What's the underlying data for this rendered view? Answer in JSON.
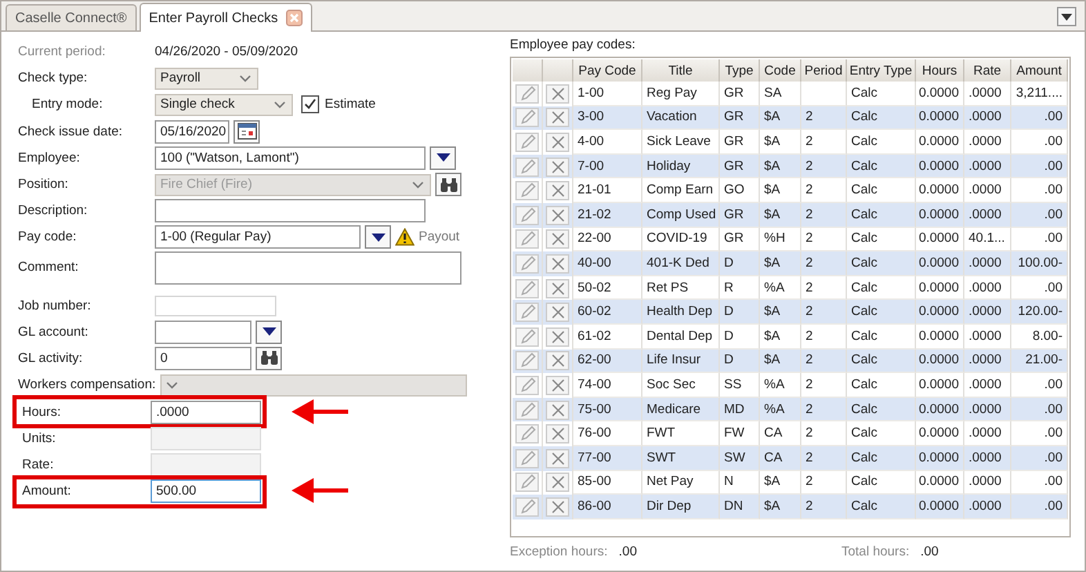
{
  "tabs": [
    {
      "label": "Caselle Connect®",
      "selected": false,
      "closable": false
    },
    {
      "label": "Enter Payroll Checks",
      "selected": true,
      "closable": true
    }
  ],
  "form": {
    "current_period": {
      "label": "Current period:",
      "value": "04/26/2020 - 05/09/2020"
    },
    "check_type": {
      "label": "Check type:",
      "value": "Payroll"
    },
    "entry_mode": {
      "label": "Entry mode:",
      "value": "Single check"
    },
    "estimate": {
      "label": "Estimate",
      "checked": true
    },
    "check_issue_date": {
      "label": "Check issue date:",
      "value": "05/16/2020"
    },
    "employee": {
      "label": "Employee:",
      "value": "100 (\"Watson, Lamont\")"
    },
    "position": {
      "label": "Position:",
      "value": "Fire Chief (Fire)",
      "disabled": true
    },
    "description": {
      "label": "Description:"
    },
    "pay_code": {
      "label": "Pay code:",
      "value": "1-00 (Regular Pay)",
      "warning": true,
      "payout": "Payout"
    },
    "comment": {
      "label": "Comment:"
    },
    "job_number": {
      "label": "Job number:"
    },
    "gl_account": {
      "label": "GL account:"
    },
    "gl_activity": {
      "label": "GL activity:",
      "value": "0"
    },
    "workers_compensation": {
      "label": "Workers compensation:",
      "disabled": true
    },
    "hours": {
      "label": "Hours:",
      "value": ".0000",
      "highlighted": true,
      "disabled": false
    },
    "units": {
      "label": "Units:",
      "highlighted": false,
      "disabled": true
    },
    "rate": {
      "label": "Rate:",
      "highlighted": false,
      "disabled": true
    },
    "amount": {
      "label": "Amount:",
      "value": "500.00",
      "highlighted": true,
      "disabled": false
    }
  },
  "pay_codes": {
    "title": "Employee pay codes:",
    "columns": [
      "Pay Code",
      "Title",
      "Type",
      "Code",
      "Period",
      "Entry Type",
      "Hours",
      "Rate",
      "Amount"
    ],
    "rows": [
      [
        "1-00",
        "Reg Pay",
        "GR",
        "SA",
        "",
        "Calc",
        "0.0000",
        ".0000",
        "3,211...."
      ],
      [
        "3-00",
        "Vacation",
        "GR",
        "$A",
        "2",
        "Calc",
        "0.0000",
        ".0000",
        ".00"
      ],
      [
        "4-00",
        "Sick Leave",
        "GR",
        "$A",
        "2",
        "Calc",
        "0.0000",
        ".0000",
        ".00"
      ],
      [
        "7-00",
        "Holiday",
        "GR",
        "$A",
        "2",
        "Calc",
        "0.0000",
        ".0000",
        ".00"
      ],
      [
        "21-01",
        "Comp Earn",
        "GO",
        "$A",
        "2",
        "Calc",
        "0.0000",
        ".0000",
        ".00"
      ],
      [
        "21-02",
        "Comp Used",
        "GR",
        "$A",
        "2",
        "Calc",
        "0.0000",
        ".0000",
        ".00"
      ],
      [
        "22-00",
        "COVID-19",
        "GR",
        "%H",
        "2",
        "Calc",
        "0.0000",
        "40.1...",
        ".00"
      ],
      [
        "40-00",
        "401-K Ded",
        "D",
        "$A",
        "2",
        "Calc",
        "0.0000",
        ".0000",
        "100.00-"
      ],
      [
        "50-02",
        "Ret PS",
        "R",
        "%A",
        "2",
        "Calc",
        "0.0000",
        ".0000",
        ".00"
      ],
      [
        "60-02",
        "Health Dep",
        "D",
        "$A",
        "2",
        "Calc",
        "0.0000",
        ".0000",
        "120.00-"
      ],
      [
        "61-02",
        "Dental Dep",
        "D",
        "$A",
        "2",
        "Calc",
        "0.0000",
        ".0000",
        "8.00-"
      ],
      [
        "62-00",
        "Life Insur",
        "D",
        "$A",
        "2",
        "Calc",
        "0.0000",
        ".0000",
        "21.00-"
      ],
      [
        "74-00",
        "Soc Sec",
        "SS",
        "%A",
        "2",
        "Calc",
        "0.0000",
        ".0000",
        ".00"
      ],
      [
        "75-00",
        "Medicare",
        "MD",
        "%A",
        "2",
        "Calc",
        "0.0000",
        ".0000",
        ".00"
      ],
      [
        "76-00",
        "FWT",
        "FW",
        "CA",
        "2",
        "Calc",
        "0.0000",
        ".0000",
        ".00"
      ],
      [
        "77-00",
        "SWT",
        "SW",
        "CA",
        "2",
        "Calc",
        "0.0000",
        ".0000",
        ".00"
      ],
      [
        "85-00",
        "Net Pay",
        "N",
        "$A",
        "2",
        "Calc",
        "0.0000",
        ".0000",
        ".00"
      ],
      [
        "86-00",
        "Dir Dep",
        "DN",
        "$A",
        "2",
        "Calc",
        "0.0000",
        ".0000",
        ".00"
      ]
    ]
  },
  "exception_hours": {
    "label": "Exception hours:",
    "value": ".00"
  },
  "total_hours": {
    "label": "Total hours:",
    "value": ".00"
  }
}
